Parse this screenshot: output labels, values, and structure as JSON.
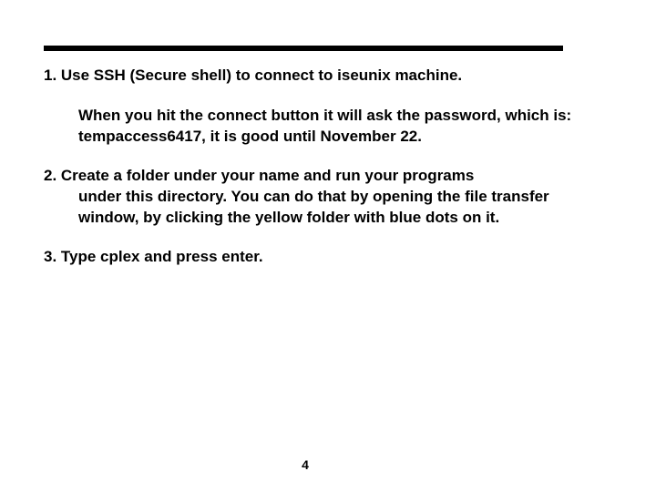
{
  "items": {
    "item1": {
      "title": "1. Use SSH (Secure shell) to connect to iseunix machine.",
      "body": "When you hit the connect button it will ask the password, which is: tempaccess6417, it is good until November 22."
    },
    "item2": {
      "title": "2. Create a folder under your name and run your programs",
      "body": "under this directory. You can do that by opening the file transfer window, by clicking the yellow folder with blue dots on it."
    },
    "item3": {
      "title": "3. Type cplex and press enter."
    }
  },
  "page_number": "4"
}
